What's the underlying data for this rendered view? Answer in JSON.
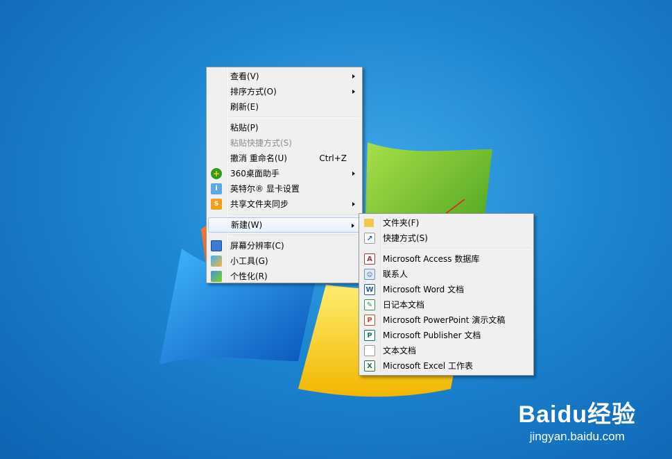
{
  "main_menu": {
    "items": [
      {
        "label": "查看(V)",
        "submenu": true
      },
      {
        "label": "排序方式(O)",
        "submenu": true
      },
      {
        "label": "刷新(E)"
      },
      {
        "label": "粘贴(P)"
      },
      {
        "label": "粘贴快捷方式(S)",
        "disabled": true
      },
      {
        "label": "撤消 重命名(U)",
        "shortcut": "Ctrl+Z"
      },
      {
        "label": "360桌面助手",
        "submenu": true,
        "icon": "360-icon"
      },
      {
        "label": "英特尔® 显卡设置",
        "icon": "intel-graphics-icon"
      },
      {
        "label": "共享文件夹同步",
        "submenu": true,
        "icon": "share-sync-icon"
      },
      {
        "label": "新建(W)",
        "submenu": true,
        "highlighted": true
      },
      {
        "label": "屏幕分辨率(C)",
        "icon": "screen-resolution-icon"
      },
      {
        "label": "小工具(G)",
        "icon": "gadgets-icon"
      },
      {
        "label": "个性化(R)",
        "icon": "personalize-icon"
      }
    ]
  },
  "new_submenu": {
    "items": [
      {
        "label": "文件夹(F)",
        "icon": "folder-icon"
      },
      {
        "label": "快捷方式(S)",
        "icon": "shortcut-icon"
      },
      {
        "label": "Microsoft Access 数据库",
        "icon": "access-icon"
      },
      {
        "label": "联系人",
        "icon": "contact-icon"
      },
      {
        "label": "Microsoft Word 文档",
        "icon": "word-icon"
      },
      {
        "label": "日记本文档",
        "icon": "journal-icon"
      },
      {
        "label": "Microsoft PowerPoint 演示文稿",
        "icon": "powerpoint-icon"
      },
      {
        "label": "Microsoft Publisher 文档",
        "icon": "publisher-icon"
      },
      {
        "label": "文本文档",
        "icon": "text-document-icon"
      },
      {
        "label": "Microsoft Excel 工作表",
        "icon": "excel-icon"
      }
    ]
  },
  "watermark": {
    "brand": "Baidu经验",
    "url": "jingyan.baidu.com"
  },
  "colors": {
    "highlight_border": "#a8caf0",
    "arrow_red": "#e02020",
    "menu_bg": "#f0f0f0"
  }
}
